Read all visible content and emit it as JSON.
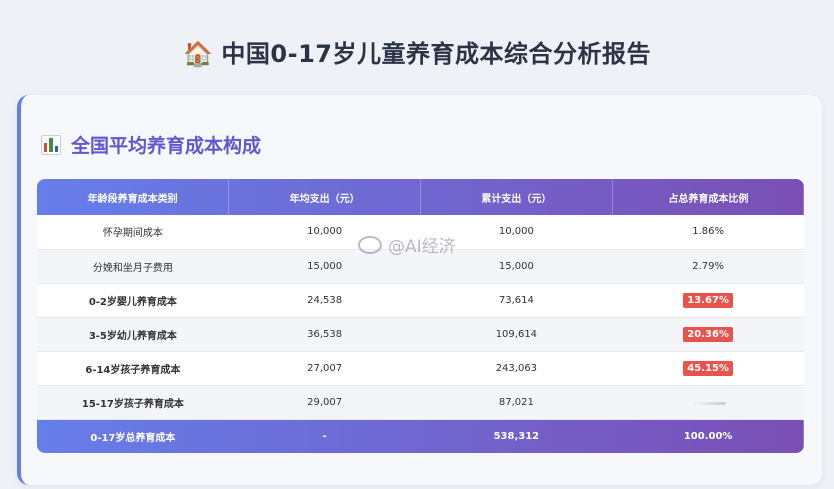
{
  "page": {
    "emoji": "🏠",
    "title": "中国0-17岁儿童养育成本综合分析报告"
  },
  "section": {
    "title": "全国平均养育成本构成"
  },
  "table": {
    "headers": [
      "年龄段养育成本类别",
      "年均支出（元）",
      "累计支出（元）",
      "占总养育成本比例"
    ],
    "rows": [
      {
        "category": "怀孕期间成本",
        "annual": "10,000",
        "cumulative": "10,000",
        "pct": "1.86%"
      },
      {
        "category": "分娩和坐月子费用",
        "annual": "15,000",
        "cumulative": "15,000",
        "pct": "2.79%"
      },
      {
        "category": "0-2岁婴儿养育成本",
        "annual": "24,538",
        "cumulative": "73,614",
        "pct": "13.67%"
      },
      {
        "category": "3-5岁幼儿养育成本",
        "annual": "36,538",
        "cumulative": "109,614",
        "pct": "20.36%"
      },
      {
        "category": "6-14岁孩子养育成本",
        "annual": "27,007",
        "cumulative": "243,063",
        "pct": "45.15%"
      },
      {
        "category": "15-17岁孩子养育成本",
        "annual": "29,007",
        "cumulative": "87,021",
        "pct": ""
      }
    ],
    "total": {
      "category": "0-17岁总养育成本",
      "annual": "-",
      "cumulative": "538,312",
      "pct": "100.00%"
    }
  },
  "watermark": {
    "text": "@AI经济"
  },
  "colors": {
    "accent": "#667eea",
    "accent_end": "#7a4fb5",
    "highlight": "#e8544d"
  }
}
